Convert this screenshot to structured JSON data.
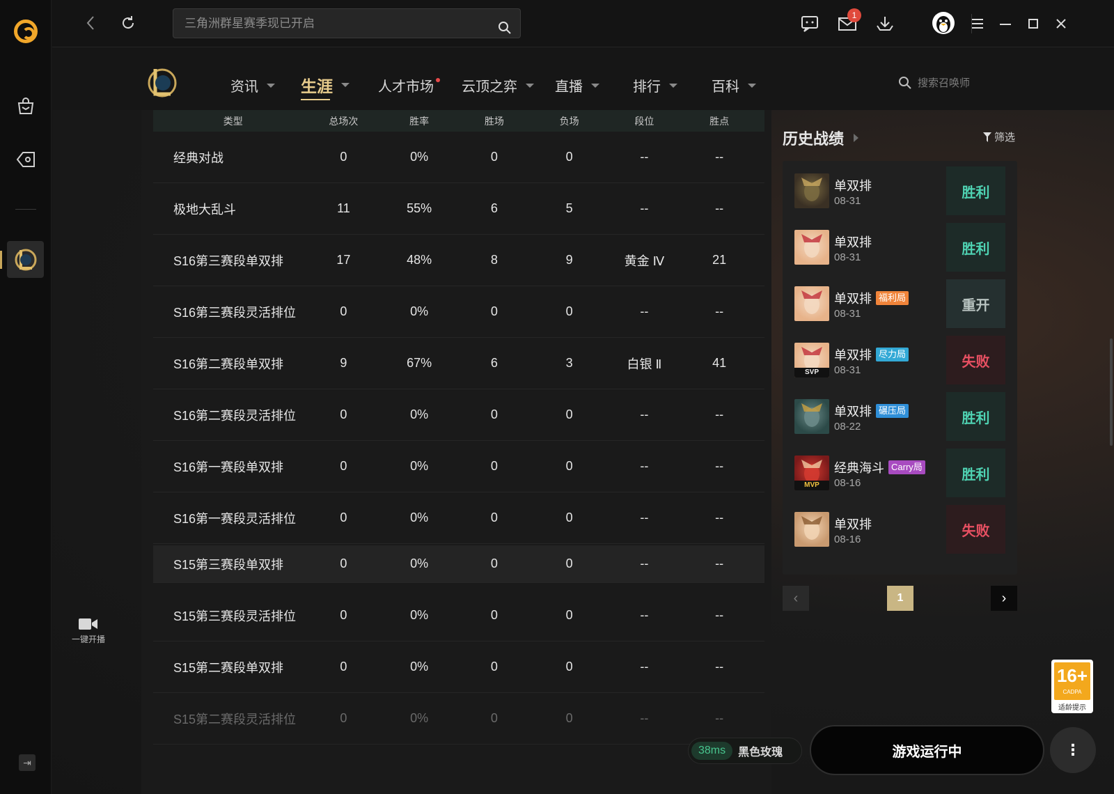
{
  "topbar": {
    "search_placeholder": "三角洲群星赛季现已开启",
    "mail_badge": "1"
  },
  "gamenav": {
    "items": [
      {
        "label": "资讯"
      },
      {
        "label": "生涯"
      },
      {
        "label": "人才市场"
      },
      {
        "label": "云顶之弈"
      },
      {
        "label": "直播"
      },
      {
        "label": "排行"
      },
      {
        "label": "百科"
      }
    ],
    "summoner_search_placeholder": "搜索召唤师"
  },
  "sidebar": {
    "live_label": "一键开播"
  },
  "stats": {
    "headers": [
      "类型",
      "总场次",
      "胜率",
      "胜场",
      "负场",
      "段位",
      "胜点"
    ],
    "rows": [
      {
        "type": "经典对战",
        "total": "0",
        "winrate": "0%",
        "wins": "0",
        "losses": "0",
        "rank": "--",
        "points": "--"
      },
      {
        "type": "极地大乱斗",
        "total": "11",
        "winrate": "55%",
        "wins": "6",
        "losses": "5",
        "rank": "--",
        "points": "--"
      },
      {
        "type": "S16第三赛段单双排",
        "total": "17",
        "winrate": "48%",
        "wins": "8",
        "losses": "9",
        "rank": "黄金 Ⅳ",
        "points": "21"
      },
      {
        "type": "S16第三赛段灵活排位",
        "total": "0",
        "winrate": "0%",
        "wins": "0",
        "losses": "0",
        "rank": "--",
        "points": "--"
      },
      {
        "type": "S16第二赛段单双排",
        "total": "9",
        "winrate": "67%",
        "wins": "6",
        "losses": "3",
        "rank": "白银 Ⅱ",
        "points": "41"
      },
      {
        "type": "S16第二赛段灵活排位",
        "total": "0",
        "winrate": "0%",
        "wins": "0",
        "losses": "0",
        "rank": "--",
        "points": "--"
      },
      {
        "type": "S16第一赛段单双排",
        "total": "0",
        "winrate": "0%",
        "wins": "0",
        "losses": "0",
        "rank": "--",
        "points": "--"
      },
      {
        "type": "S16第一赛段灵活排位",
        "total": "0",
        "winrate": "0%",
        "wins": "0",
        "losses": "0",
        "rank": "--",
        "points": "--"
      },
      {
        "type": "S15第三赛段单双排",
        "total": "0",
        "winrate": "0%",
        "wins": "0",
        "losses": "0",
        "rank": "--",
        "points": "--"
      },
      {
        "type": "S15第三赛段灵活排位",
        "total": "0",
        "winrate": "0%",
        "wins": "0",
        "losses": "0",
        "rank": "--",
        "points": "--"
      },
      {
        "type": "S15第二赛段单双排",
        "total": "0",
        "winrate": "0%",
        "wins": "0",
        "losses": "0",
        "rank": "--",
        "points": "--"
      },
      {
        "type": "S15第二赛段灵活排位",
        "total": "0",
        "winrate": "0%",
        "wins": "0",
        "losses": "0",
        "rank": "--",
        "points": "--"
      }
    ]
  },
  "history": {
    "title": "历史战绩",
    "filter_label": "筛选",
    "matches": [
      {
        "mode": "单双排",
        "date": "08-31",
        "result": "胜利",
        "result_kind": "win",
        "tag": "",
        "tag_color": "",
        "medal": ""
      },
      {
        "mode": "单双排",
        "date": "08-31",
        "result": "胜利",
        "result_kind": "win",
        "tag": "",
        "tag_color": "",
        "medal": ""
      },
      {
        "mode": "单双排",
        "date": "08-31",
        "result": "重开",
        "result_kind": "remake",
        "tag": "福利局",
        "tag_color": "#f0843a",
        "medal": ""
      },
      {
        "mode": "单双排",
        "date": "08-31",
        "result": "失败",
        "result_kind": "lose",
        "tag": "尽力局",
        "tag_color": "#33a9d6",
        "medal": "SVP"
      },
      {
        "mode": "单双排",
        "date": "08-22",
        "result": "胜利",
        "result_kind": "win",
        "tag": "碾压局",
        "tag_color": "#2f8fd8",
        "medal": ""
      },
      {
        "mode": "经典海斗",
        "date": "08-16",
        "result": "胜利",
        "result_kind": "win",
        "tag": "Carry局",
        "tag_color": "#a84bc0",
        "medal": "MVP"
      },
      {
        "mode": "单双排",
        "date": "08-16",
        "result": "失败",
        "result_kind": "lose",
        "tag": "",
        "tag_color": "",
        "medal": ""
      }
    ],
    "current_page": "1"
  },
  "footer": {
    "ping": "38ms",
    "server": "黑色玫瑰",
    "launch_label": "游戏运行中",
    "more_label": "⋮"
  },
  "age_rating": {
    "age": "16+",
    "org": "CADPA",
    "tip": "适龄提示"
  },
  "colors": {
    "accent_gold": "#e8cc8c",
    "win": "#4fd3b3",
    "lose": "#e85062",
    "brand_orange": "#f1a72a"
  }
}
